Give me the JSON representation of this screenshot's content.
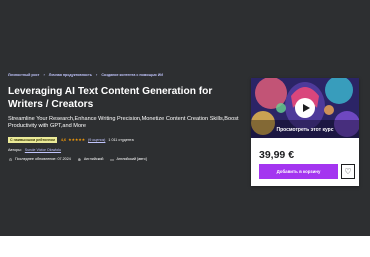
{
  "breadcrumbs": [
    "Личностный рост",
    "Личная продуктивность",
    "Создание контента с помощью ИИ"
  ],
  "breadcrumb_separator": "›",
  "course": {
    "title": "Leveraging AI Text Content Generation for Writers / Creators",
    "subtitle": "Streamline Your Research,Enhance Writing Precision,Monetize Content Creation Skills,Boost Productivity with GPT,and More",
    "badge": "С наивысшим рейтингом",
    "rating": "4,6",
    "stars": "★★★★★",
    "ratings_count": "(9 оценок)",
    "students": "1 011 студента",
    "authors_label": "Авторы:",
    "author": "Sunde Victor Olowlolu",
    "last_updated": "Последнее обновление: 07.2024",
    "language": "Английский",
    "subtitles_lang": "Английский [авто]"
  },
  "card": {
    "preview_label": "Просмотреть этот курс",
    "price": "39,99 €",
    "add_to_cart": "Добавить в корзину",
    "wishlist_icon": "♡"
  },
  "icons": {
    "update": "⊙",
    "language": "⊕",
    "captions": "▭"
  },
  "colors": {
    "hero_bg": "#2d2f31",
    "accent_link": "#c0c4fc",
    "star": "#f69c08",
    "badge_bg": "#eceb98",
    "cta": "#a435f0"
  }
}
